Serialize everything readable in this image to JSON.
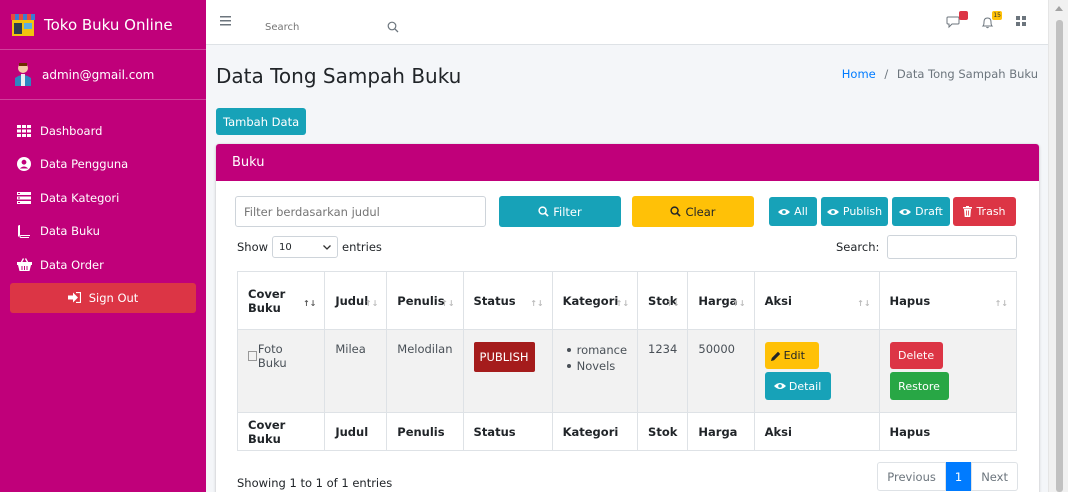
{
  "brand": {
    "name": "Toko Buku Online",
    "logo_icon": "store-icon"
  },
  "user": {
    "email": "admin@gmail.com",
    "avatar_icon": "user-avatar-icon"
  },
  "sidebar": {
    "items": [
      {
        "label": "Dashboard",
        "icon": "grid-icon"
      },
      {
        "label": "Data Pengguna",
        "icon": "user-circle-icon"
      },
      {
        "label": "Data Kategori",
        "icon": "list-icon"
      },
      {
        "label": "Data Buku",
        "icon": "book-icon"
      },
      {
        "label": "Data Order",
        "icon": "shopping-basket-icon"
      }
    ],
    "signout_label": "Sign Out"
  },
  "topbar": {
    "search_placeholder": "Search",
    "notifications": [
      {
        "icon": "comments-icon",
        "badge": ""
      },
      {
        "icon": "bell-icon",
        "badge": "15"
      }
    ]
  },
  "page": {
    "title": "Data Tong Sampah Buku",
    "breadcrumb_home": "Home",
    "breadcrumb_sep": "/",
    "breadcrumb_current": "Data Tong Sampah Buku",
    "add_button": "Tambah Data"
  },
  "card": {
    "title": "Buku",
    "filter_placeholder": "Filter berdasarkan judul",
    "filter_button": "Filter",
    "clear_button": "Clear",
    "all_button": "All",
    "publish_button": "Publish",
    "draft_button": "Draft",
    "trash_button": "Trash",
    "show_label": "Show",
    "entries_value": "10",
    "entries_label": "entries",
    "search_label": "Search:"
  },
  "table": {
    "headers": [
      "Cover Buku",
      "Judul",
      "Penulis",
      "Status",
      "Kategori",
      "Stok",
      "Harga",
      "Aksi",
      "Hapus"
    ],
    "header_cover_line1": "Cover",
    "header_cover_line2": "Buku",
    "rows": [
      {
        "cover_alt": "Foto Buku",
        "judul": "Milea",
        "penulis": "Melodilan",
        "status": "PUBLISH",
        "kategori": [
          "romance",
          "Novels"
        ],
        "stok": "1234",
        "harga": "50000",
        "edit_label": "Edit",
        "detail_label": "Detail",
        "delete_label": "Delete",
        "restore_label": "Restore"
      }
    ],
    "footer": [
      "Cover Buku",
      "Judul",
      "Penulis",
      "Status",
      "Kategori",
      "Stok",
      "Harga",
      "Aksi",
      "Hapus"
    ]
  },
  "pagination": {
    "info": "Showing 1 to 1 of 1 entries",
    "previous": "Previous",
    "current": "1",
    "next": "Next"
  },
  "colors": {
    "sidebar": "#c0007a",
    "info": "#17a2b8",
    "warning": "#ffc107",
    "danger": "#dc3545",
    "success": "#28a745",
    "primary": "#007bff"
  }
}
